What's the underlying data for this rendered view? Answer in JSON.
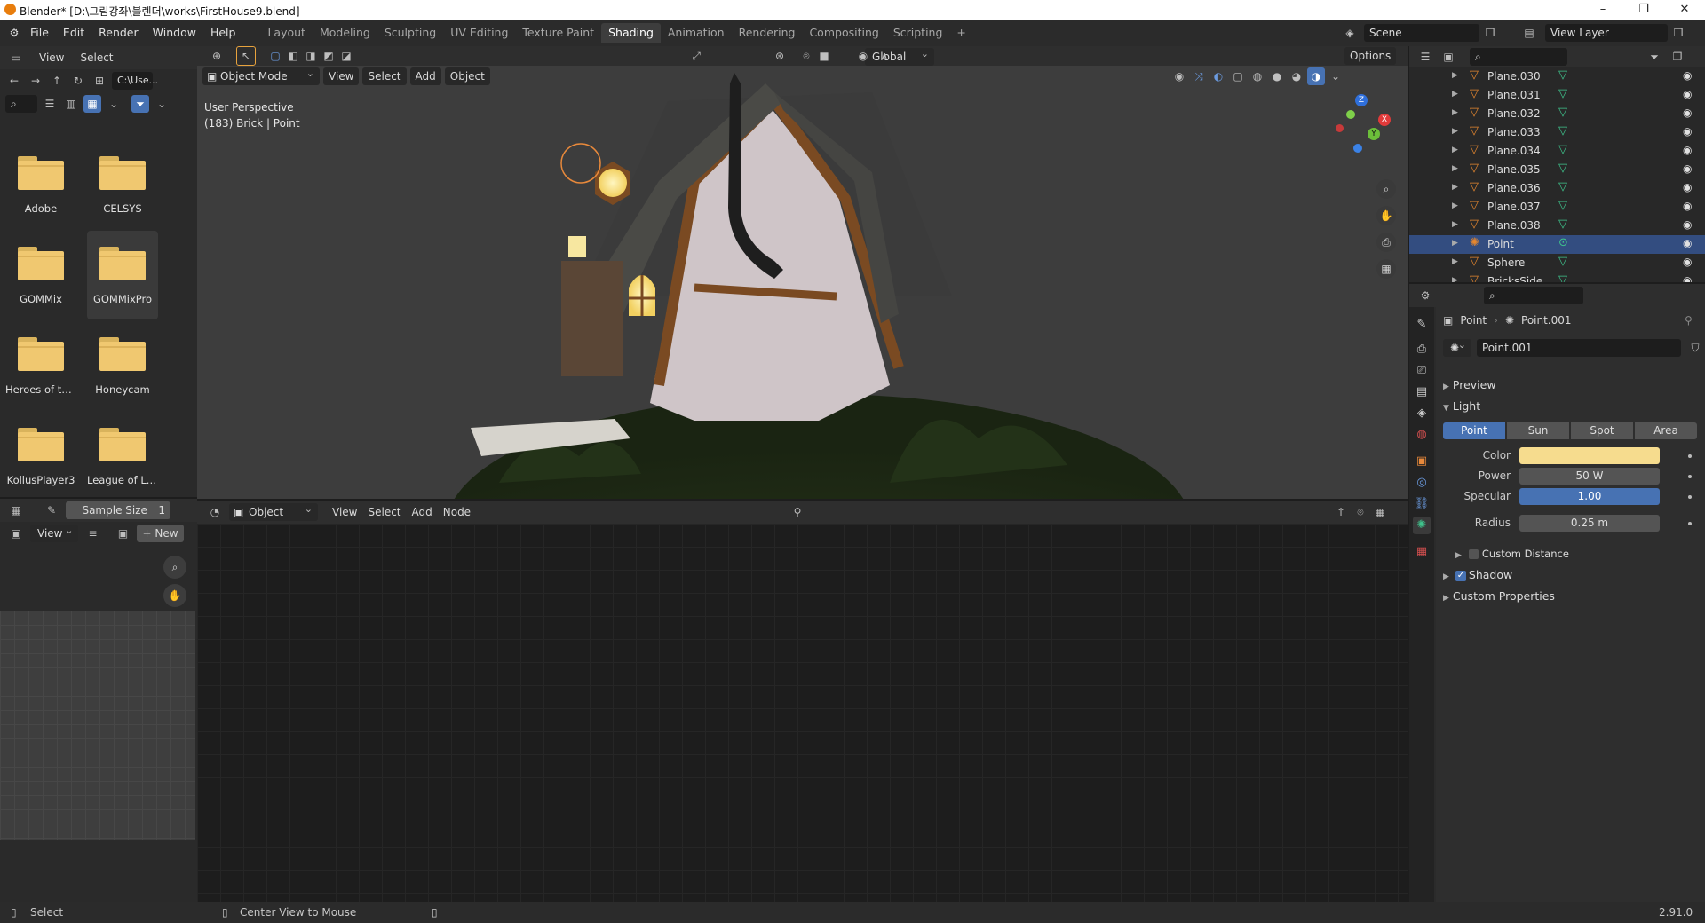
{
  "titlebar": {
    "title": "Blender* [D:\\그림강좌\\블렌더\\works\\FirstHouse9.blend]",
    "minimize": "–",
    "restore": "❐",
    "close": "✕"
  },
  "menu": {
    "items": [
      "File",
      "Edit",
      "Render",
      "Window",
      "Help"
    ]
  },
  "workspaces": {
    "tabs": [
      "Layout",
      "Modeling",
      "Sculpting",
      "UV Editing",
      "Texture Paint",
      "Shading",
      "Animation",
      "Rendering",
      "Compositing",
      "Scripting"
    ],
    "active": "Shading",
    "add": "+"
  },
  "scene": {
    "label": "Scene",
    "view_layer": "View Layer"
  },
  "filebrowser": {
    "header": [
      "View",
      "Select"
    ],
    "path": "C:\\Use...",
    "folders": [
      "Adobe",
      "CELSYS",
      "GOMMix",
      "GOMMixPro",
      "Heroes of the ...",
      "Honeycam",
      "KollusPlayer3",
      "League of Leg..."
    ]
  },
  "imageeditor": {
    "sample_size": "Sample Size",
    "sample_value": "1",
    "view": "View",
    "new": "New"
  },
  "viewport": {
    "header": {
      "mode": "Object Mode",
      "menus": [
        "View",
        "Select",
        "Add",
        "Object"
      ],
      "orientation": "Global",
      "options": "Options"
    },
    "overlay_text": {
      "perspective": "User Perspective",
      "info": "(183) Brick | Point"
    },
    "gizmo": {
      "x": "X",
      "y": "Y",
      "z": "Z"
    }
  },
  "nodeeditor": {
    "header": {
      "type": "Object",
      "menus": [
        "View",
        "Select",
        "Add",
        "Node"
      ]
    }
  },
  "outliner": {
    "rows": [
      {
        "name": "Plane.030",
        "type": "mesh"
      },
      {
        "name": "Plane.031",
        "type": "mesh"
      },
      {
        "name": "Plane.032",
        "type": "mesh"
      },
      {
        "name": "Plane.033",
        "type": "mesh"
      },
      {
        "name": "Plane.034",
        "type": "mesh"
      },
      {
        "name": "Plane.035",
        "type": "mesh"
      },
      {
        "name": "Plane.036",
        "type": "mesh"
      },
      {
        "name": "Plane.037",
        "type": "mesh"
      },
      {
        "name": "Plane.038",
        "type": "mesh"
      },
      {
        "name": "Point",
        "type": "light",
        "selected": true
      },
      {
        "name": "Sphere",
        "type": "mesh"
      },
      {
        "name": "BricksSide",
        "type": "mesh"
      }
    ]
  },
  "properties": {
    "breadcrumb": {
      "object": "Point",
      "data": "Point.001"
    },
    "datablock": "Point.001",
    "sections": {
      "preview": "Preview",
      "light": "Light",
      "custom_distance": "Custom Distance",
      "shadow": "Shadow",
      "custom_props": "Custom Properties"
    },
    "light_types": [
      "Point",
      "Sun",
      "Spot",
      "Area"
    ],
    "active_type": "Point",
    "fields": {
      "color_label": "Color",
      "color_value": "#f6dc8e",
      "power_label": "Power",
      "power_value": "50 W",
      "specular_label": "Specular",
      "specular_value": "1.00",
      "radius_label": "Radius",
      "radius_value": "0.25 m"
    }
  },
  "statusbar": {
    "left": "Select",
    "middle": "Center View to Mouse",
    "version": "2.91.0"
  }
}
